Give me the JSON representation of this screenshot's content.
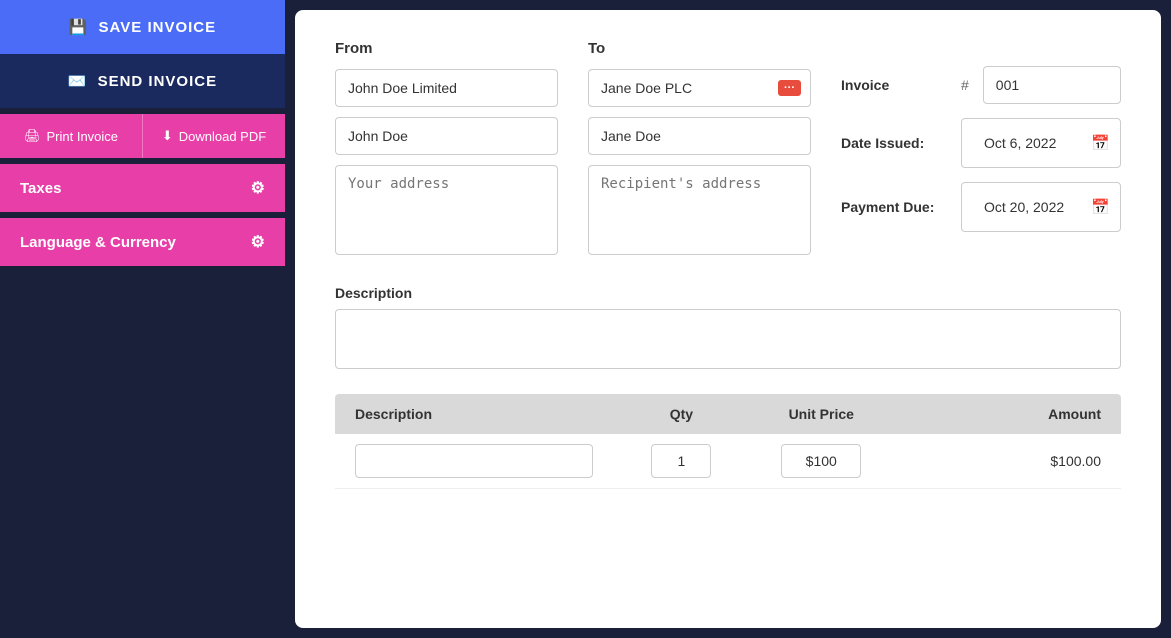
{
  "sidebar": {
    "save_invoice_label": "SAVE INVOICE",
    "send_invoice_label": "SEND INVOICE",
    "print_invoice_label": "Print Invoice",
    "download_pdf_label": "Download PDF",
    "taxes_label": "Taxes",
    "language_currency_label": "Language & Currency"
  },
  "form": {
    "from_label": "From",
    "to_label": "To",
    "from_name": "John Doe",
    "from_company": "John Doe Limited",
    "from_address_placeholder": "Your address",
    "to_company": "Jane Doe PLC",
    "to_name": "Jane Doe",
    "to_address_placeholder": "Recipient's address",
    "invoice_label": "Invoice",
    "invoice_hash": "#",
    "invoice_number": "001",
    "date_issued_label": "Date Issued:",
    "date_issued_value": "Oct 6, 2022",
    "payment_due_label": "Payment Due:",
    "payment_due_value": "Oct 20, 2022",
    "description_label": "Description",
    "description_placeholder": ""
  },
  "table": {
    "col_description": "Description",
    "col_qty": "Qty",
    "col_unit_price": "Unit Price",
    "col_amount": "Amount",
    "rows": [
      {
        "description": "",
        "qty": "1",
        "unit_price": "$100",
        "amount": "$100.00"
      }
    ]
  }
}
